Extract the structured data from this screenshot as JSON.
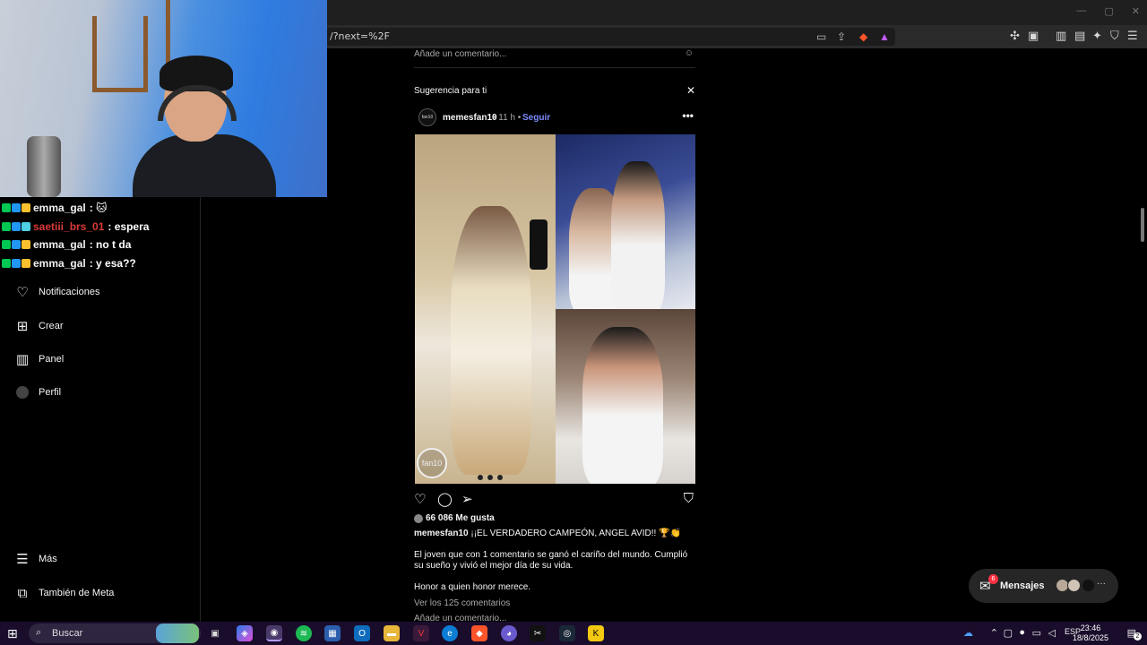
{
  "browser": {
    "url": "/?next=%2F",
    "window_controls": [
      "—",
      "▢",
      "✕"
    ]
  },
  "chat": [
    {
      "user": "emma_gal",
      "message": ": 🐱",
      "user_color": "#f0f0f0"
    },
    {
      "user": "saetiii_brs_01",
      "message": ": espera",
      "user_color": "#d93a3a"
    },
    {
      "user": "emma_gal",
      "message": ": no t da",
      "user_color": "#f0f0f0"
    },
    {
      "user": "emma_gal",
      "message": ": y esa??",
      "user_color": "#f0f0f0"
    }
  ],
  "nav": {
    "items": [
      {
        "label": "Notificaciones",
        "icon": "heart-icon"
      },
      {
        "label": "Crear",
        "icon": "plus-square-icon"
      },
      {
        "label": "Panel",
        "icon": "chart-icon"
      },
      {
        "label": "Perfil",
        "icon": "profile-avatar-icon"
      }
    ],
    "more": "Más",
    "meta": "También de Meta"
  },
  "feed": {
    "prev_comment_placeholder": "Añade un comentario...",
    "suggestion_title": "Sugerencia para ti",
    "post": {
      "username": "memesfan10",
      "time": "• 11 h •",
      "follow": "Seguir",
      "avatar_text": "fan10",
      "image_logo": "fan10",
      "likes": "66 086 Me gusta",
      "caption_user": "memesfan10",
      "caption_title": "¡¡EL VERDADERO CAMPEÓN, ANGEL AVID!! 🏆👏",
      "caption_body": "El joven que con 1 comentario se ganó el cariño del mundo. Cumplió su sueño y vivió el mejor día de su vida.",
      "caption_end": "Honor a quien honor merece.",
      "view_comments": "Ver los 125 comentarios",
      "comment_placeholder": "Añade un comentario..."
    }
  },
  "messages": {
    "label": "Mensajes",
    "badge": "6"
  },
  "taskbar": {
    "search": "Buscar",
    "lang": "ESP",
    "time": "23:46",
    "date": "18/8/2025",
    "notif_count": "2"
  },
  "colors": {
    "accent_link": "#7d8cff",
    "background": "#000000",
    "taskbar": "#1a0d2b",
    "badge_red": "#ff3040"
  }
}
